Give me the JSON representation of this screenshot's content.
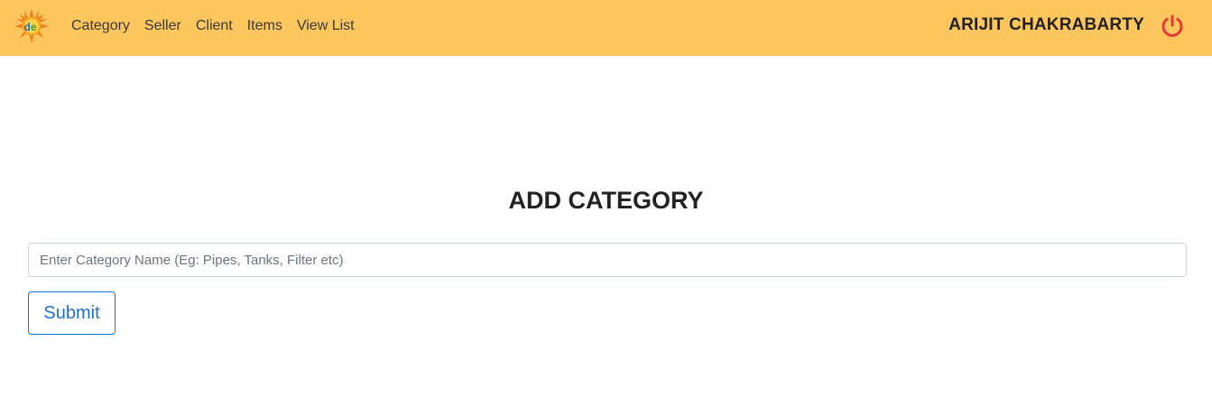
{
  "navbar": {
    "logo_icon": "sun-logo-icon",
    "links": [
      {
        "label": "Category"
      },
      {
        "label": "Seller"
      },
      {
        "label": "Client"
      },
      {
        "label": "Items"
      },
      {
        "label": "View List"
      }
    ],
    "user_name": "ARIJIT CHAKRABARTY",
    "logout_icon": "power-icon",
    "colors": {
      "background": "#fcc65e",
      "power_icon": "#e53935"
    }
  },
  "main": {
    "title": "ADD CATEGORY",
    "category_input": {
      "placeholder": "Enter Category Name (Eg: Pipes, Tanks, Filter etc)",
      "value": ""
    },
    "submit_label": "Submit",
    "colors": {
      "submit_accent": "#1f6fd1"
    }
  }
}
